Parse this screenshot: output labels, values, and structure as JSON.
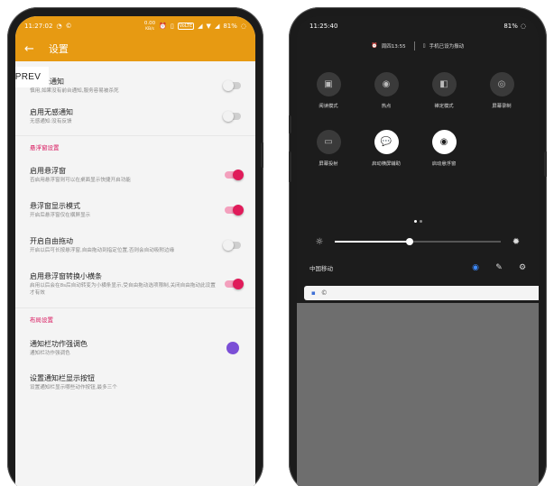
{
  "left": {
    "status": {
      "time": "11:27:02",
      "net_speed": "0.00",
      "net_unit": "KB/s",
      "volte": "VoLTE",
      "battery": "81%"
    },
    "appbar": {
      "title": "设置"
    },
    "prev_label": "PREV",
    "rows_top": [
      {
        "title": "不显示通知",
        "title_visible": "示通知",
        "subtitle": "慎用,如果没有前台通知,服务容易被杀死",
        "switch": "off"
      },
      {
        "title": "启用无感通知",
        "subtitle": "无感通知:没有反馈",
        "switch": "off"
      }
    ],
    "section_float": "悬浮窗设置",
    "rows_float": [
      {
        "title": "启用悬浮窗",
        "subtitle": "否启用悬浮窗则可以在桌面显示快捷开启功能",
        "switch": "on"
      },
      {
        "title": "悬浮窗显示模式",
        "subtitle": "开启后悬浮窗仅在横屏显示",
        "switch": "on"
      },
      {
        "title": "开启自由拖动",
        "subtitle": "开启以后可长按悬浮窗,自由拖动到指定位置,否则会自动吸附边缘",
        "switch": "off"
      },
      {
        "title": "启用悬浮窗转换小横条",
        "subtitle": "启用以后会在8s后自动转变为小横条显示,受自由拖动选项限制,关闭自由拖动此设置才有效",
        "switch": "on"
      }
    ],
    "section_layout": "布局设置",
    "rows_layout": [
      {
        "title": "通知栏功作强调色",
        "subtitle": "通知栏功作强调色",
        "color": "#7b4fd6"
      },
      {
        "title": "设置通知栏显示按钮",
        "subtitle": "设置通知栏显示哪些动作按钮,最多三个"
      }
    ]
  },
  "right": {
    "status": {
      "time": "11:25:40",
      "battery": "81%"
    },
    "info": {
      "alarm": "周四13:55",
      "ring_mode": "手机已设为振动"
    },
    "tiles": [
      {
        "label": "阅读模式",
        "icon": "book-icon",
        "glyph": "▣",
        "active": false
      },
      {
        "label": "热点",
        "icon": "hotspot-icon",
        "glyph": "◉",
        "active": false
      },
      {
        "label": "禅定模式",
        "icon": "zen-mode-icon",
        "glyph": "◧",
        "active": false
      },
      {
        "label": "屏幕录制",
        "icon": "screen-record-icon",
        "glyph": "◎",
        "active": false
      },
      {
        "label": "屏幕投射",
        "icon": "cast-icon",
        "glyph": "▭",
        "active": false
      },
      {
        "label": "启动横屏辅助",
        "icon": "chat-bubble-icon",
        "glyph": "💬",
        "active": true
      },
      {
        "label": "启动悬浮窗",
        "icon": "record-dot-icon",
        "glyph": "◉",
        "active": true
      }
    ],
    "brightness_level": 0.45,
    "carrier": "中国移动"
  },
  "colors": {
    "accent_orange": "#e79a12",
    "accent_pink": "#e01b5a",
    "section_pink": "#d8145c"
  }
}
